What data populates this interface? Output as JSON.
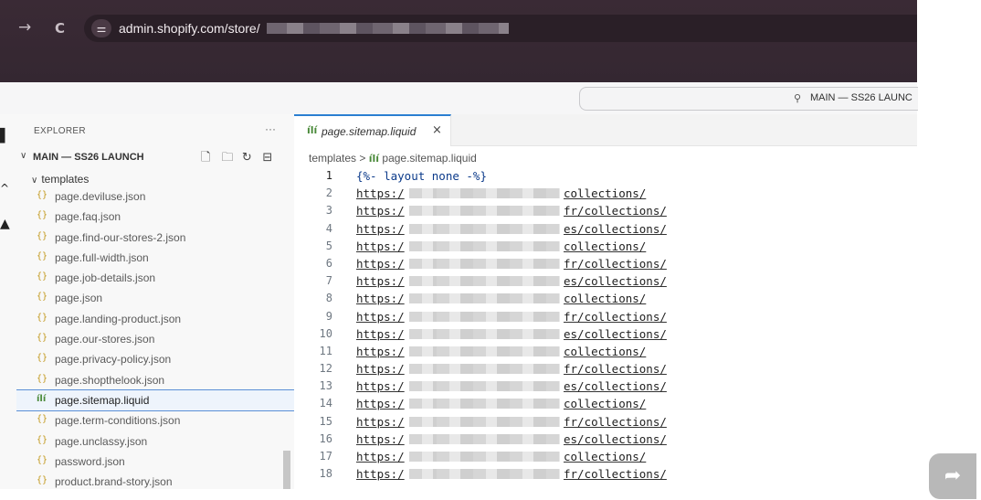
{
  "browser": {
    "back_icon": "→",
    "reload_icon": "C",
    "site_settings_icon": "tune-icon",
    "url": "admin.shopify.com/store/"
  },
  "admin": {
    "search": {
      "icon": "search-icon",
      "label": "MAIN — SS26 LAUNC"
    }
  },
  "explorer": {
    "title": "EXPLORER",
    "more": "···",
    "workspace": "MAIN — SS26 LAUNCH",
    "folder": "templates",
    "files": [
      {
        "name": "page.deviluse.json",
        "selected": false
      },
      {
        "name": "page.faq.json",
        "selected": false
      },
      {
        "name": "page.find-our-stores-2.json",
        "selected": false
      },
      {
        "name": "page.full-width.json",
        "selected": false
      },
      {
        "name": "page.job-details.json",
        "selected": false
      },
      {
        "name": "page.json",
        "selected": false
      },
      {
        "name": "page.landing-product.json",
        "selected": false
      },
      {
        "name": "page.our-stores.json",
        "selected": false
      },
      {
        "name": "page.privacy-policy.json",
        "selected": false
      },
      {
        "name": "page.shopthelook.json",
        "selected": false
      },
      {
        "name": "page.sitemap.liquid",
        "selected": true
      },
      {
        "name": "page.term-conditions.json",
        "selected": false
      },
      {
        "name": "page.unclassy.json",
        "selected": false
      },
      {
        "name": "password.json",
        "selected": false
      },
      {
        "name": "product.brand-story.json",
        "selected": false
      }
    ]
  },
  "editor": {
    "tab_label": "page.sitemap.liquid",
    "tab_close": "×",
    "breadcrumb_folder": "templates",
    "breadcrumb_sep": ">",
    "breadcrumb_file": "page.sitemap.liquid",
    "lines": [
      {
        "num": "1",
        "text": "{%- layout none -%}"
      },
      {
        "num": "2",
        "start": "https:/",
        "end": "collections/"
      },
      {
        "num": "3",
        "start": "https:/",
        "end": "fr/collections/"
      },
      {
        "num": "4",
        "start": "https:/",
        "end": "es/collections/"
      },
      {
        "num": "5",
        "start": "https:/",
        "end": "collections/"
      },
      {
        "num": "6",
        "start": "https:/",
        "end": "fr/collections/"
      },
      {
        "num": "7",
        "start": "https:/",
        "end": "es/collections/"
      },
      {
        "num": "8",
        "start": "https:/",
        "end": "collections/"
      },
      {
        "num": "9",
        "start": "https:/",
        "end": "fr/collections/"
      },
      {
        "num": "10",
        "start": "https:/",
        "end": "es/collections/"
      },
      {
        "num": "11",
        "start": "https:/",
        "end": "collections/"
      },
      {
        "num": "12",
        "start": "https:/",
        "end": "fr/collections/"
      },
      {
        "num": "13",
        "start": "https:/",
        "end": "es/collections/"
      },
      {
        "num": "14",
        "start": "https:/",
        "end": "collections/"
      },
      {
        "num": "15",
        "start": "https:/",
        "end": "fr/collections/"
      },
      {
        "num": "16",
        "start": "https:/",
        "end": "es/collections/"
      },
      {
        "num": "17",
        "start": "https:/",
        "end": "collections/"
      },
      {
        "num": "18",
        "start": "https:/",
        "end": "fr/collections/"
      }
    ]
  },
  "share": {
    "icon": "share-arrow-icon"
  }
}
